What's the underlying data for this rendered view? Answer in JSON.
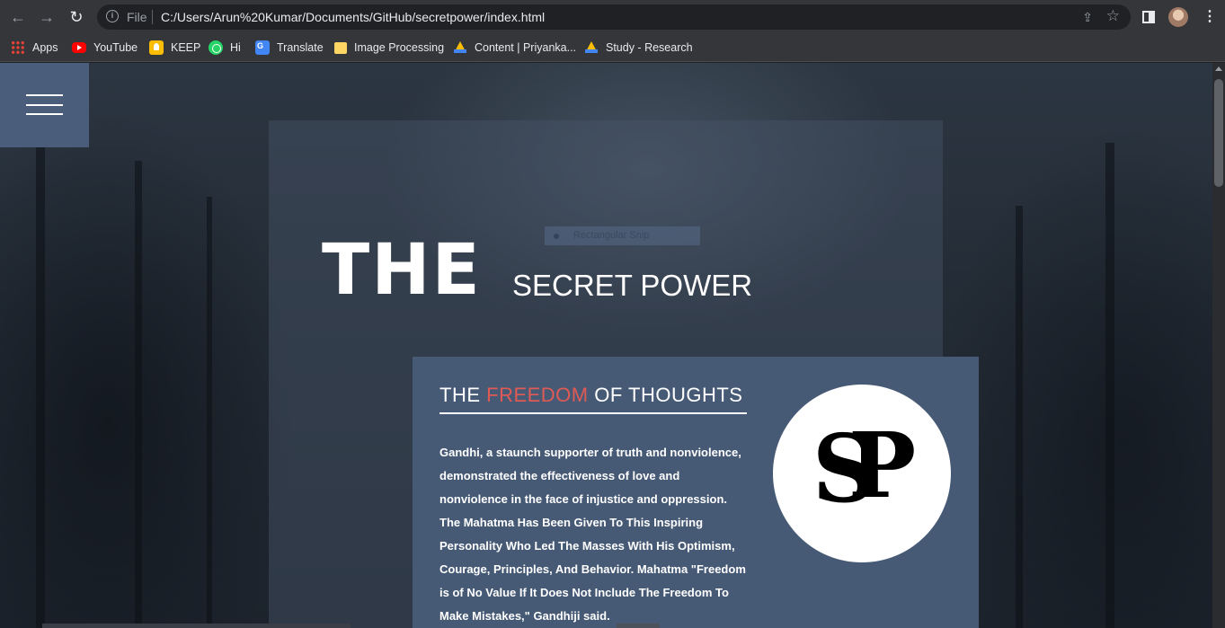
{
  "browser": {
    "address_file_label": "File",
    "url": "C:/Users/Arun%20Kumar/Documents/GitHub/secretpower/index.html",
    "bookmarks": [
      {
        "label": "Apps",
        "icon": "apps-grid-icon"
      },
      {
        "label": "YouTube",
        "icon": "youtube-icon"
      },
      {
        "label": "KEEP",
        "icon": "keep-icon"
      },
      {
        "label": "Hi",
        "icon": "whatsapp-icon"
      },
      {
        "label": "Translate",
        "icon": "translate-icon"
      },
      {
        "label": "Image Processing",
        "icon": "folder-icon"
      },
      {
        "label": "Content | Priyanka...",
        "icon": "drive-icon"
      },
      {
        "label": "Study - Research",
        "icon": "drive-icon"
      }
    ]
  },
  "page": {
    "hero_the": "THE",
    "hero_subtitle": "SECRET POWER",
    "snip_overlay": "Rectangular Snip",
    "card": {
      "title_prefix": "THE ",
      "title_accent": "FREEDOM",
      "title_suffix": " OF THOUGHTS",
      "accent_color": "#e05a55",
      "body": "Gandhi, a staunch supporter of truth and nonviolence, demonstrated the effectiveness of love and nonviolence in the face of injustice and oppression. The Mahatma Has Been Given To This Inspiring Personality Who Led The Masses With His Optimism, Courage, Principles, And Behavior. Mahatma \"Freedom is of No Value If It Does Not Include The Freedom To Make Mistakes,\" Gandhiji said.",
      "logo_letters": {
        "s": "S",
        "p": "P"
      }
    },
    "colors": {
      "menu_button": "#4a5d7a",
      "card_bg": "#465a76"
    }
  }
}
